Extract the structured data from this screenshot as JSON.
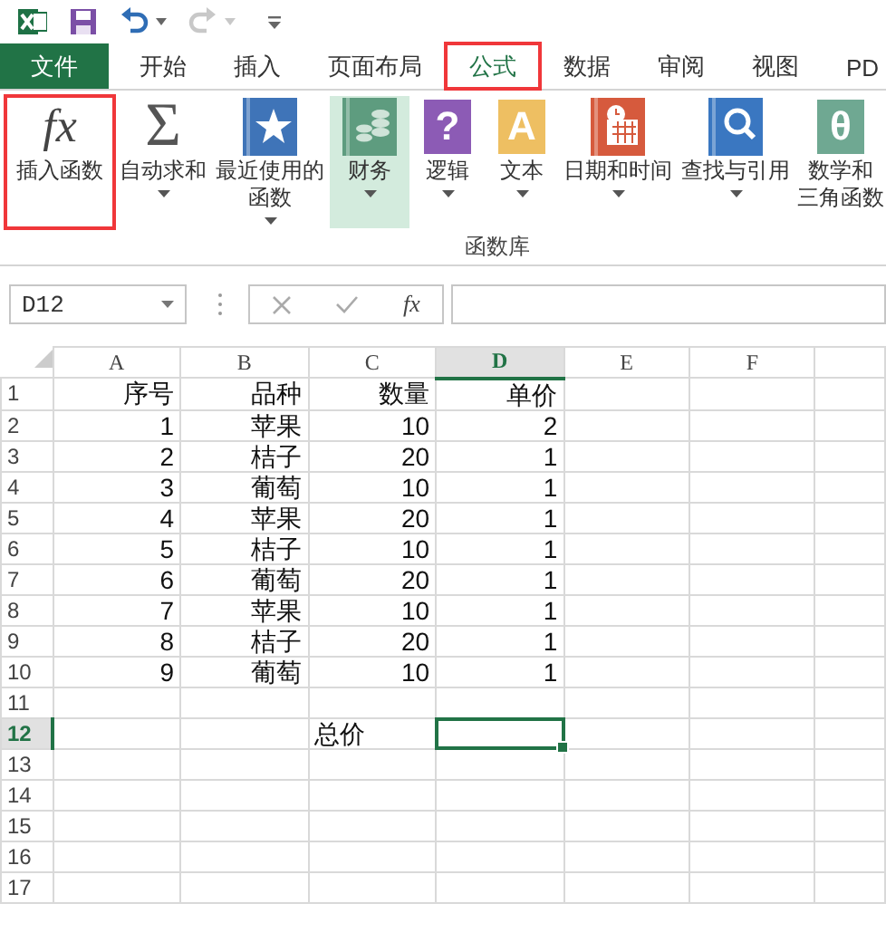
{
  "tabs": [
    {
      "label": "文件",
      "kind": "file",
      "selected": false,
      "highlighted": false
    },
    {
      "label": "开始",
      "kind": "tab",
      "selected": false,
      "highlighted": false
    },
    {
      "label": "插入",
      "kind": "tab",
      "selected": false,
      "highlighted": false
    },
    {
      "label": "页面布局",
      "kind": "tab",
      "selected": false,
      "highlighted": false
    },
    {
      "label": "公式",
      "kind": "tab",
      "selected": true,
      "highlighted": true
    },
    {
      "label": "数据",
      "kind": "tab",
      "selected": false,
      "highlighted": false
    },
    {
      "label": "审阅",
      "kind": "tab",
      "selected": false,
      "highlighted": false
    },
    {
      "label": "视图",
      "kind": "tab",
      "selected": false,
      "highlighted": false
    },
    {
      "label": "PD",
      "kind": "tab",
      "selected": false,
      "highlighted": false
    }
  ],
  "ribbon": {
    "group_label": "函数库",
    "buttons": [
      {
        "lines": [
          "插入函数"
        ],
        "kind": "glyph",
        "icon_text": "fx",
        "dropdown": false,
        "highlighted": true,
        "hovered": false
      },
      {
        "lines": [
          "自动求和"
        ],
        "kind": "glyph",
        "icon_text": "Σ",
        "dropdown": true,
        "highlighted": false,
        "hovered": false
      },
      {
        "lines": [
          "最近使用的",
          "函数"
        ],
        "kind": "star",
        "color": "#3f74b8",
        "dropdown": true,
        "highlighted": false,
        "hovered": false
      },
      {
        "lines": [
          "财务"
        ],
        "kind": "coins",
        "color": "#5e9c7f",
        "dropdown": true,
        "highlighted": false,
        "hovered": true
      },
      {
        "lines": [
          "逻辑"
        ],
        "kind": "letter",
        "icon_text": "?",
        "color": "#8c5bb5",
        "dropdown": true,
        "highlighted": false,
        "hovered": false
      },
      {
        "lines": [
          "文本"
        ],
        "kind": "letter",
        "icon_text": "A",
        "color": "#eebf62",
        "dropdown": true,
        "highlighted": false,
        "hovered": false
      },
      {
        "lines": [
          "日期和时间"
        ],
        "kind": "calendar",
        "color": "#d65a3d",
        "dropdown": true,
        "highlighted": false,
        "hovered": false
      },
      {
        "lines": [
          "查找与引用"
        ],
        "kind": "search",
        "color": "#3a77c1",
        "dropdown": true,
        "highlighted": false,
        "hovered": false
      },
      {
        "lines": [
          "数学和",
          "三角函数"
        ],
        "kind": "letter",
        "icon_text": "θ",
        "color": "#6fa892",
        "dropdown": false,
        "highlighted": false,
        "hovered": false
      }
    ]
  },
  "formula_bar": {
    "name_box": "D12",
    "fx": "fx"
  },
  "sheet": {
    "columns": [
      {
        "label": "A",
        "selected": false
      },
      {
        "label": "B",
        "selected": false
      },
      {
        "label": "C",
        "selected": false
      },
      {
        "label": "D",
        "selected": true
      },
      {
        "label": "E",
        "selected": false
      },
      {
        "label": "F",
        "selected": false
      }
    ],
    "rows": [
      {
        "label": "1",
        "selected": false,
        "cells": [
          "序号",
          "品种",
          "数量",
          "单价"
        ]
      },
      {
        "label": "2",
        "selected": false,
        "cells": [
          "1",
          "苹果",
          "10",
          "2"
        ]
      },
      {
        "label": "3",
        "selected": false,
        "cells": [
          "2",
          "桔子",
          "20",
          "1"
        ]
      },
      {
        "label": "4",
        "selected": false,
        "cells": [
          "3",
          "葡萄",
          "10",
          "1"
        ]
      },
      {
        "label": "5",
        "selected": false,
        "cells": [
          "4",
          "苹果",
          "20",
          "1"
        ]
      },
      {
        "label": "6",
        "selected": false,
        "cells": [
          "5",
          "桔子",
          "10",
          "1"
        ]
      },
      {
        "label": "7",
        "selected": false,
        "cells": [
          "6",
          "葡萄",
          "20",
          "1"
        ]
      },
      {
        "label": "8",
        "selected": false,
        "cells": [
          "7",
          "苹果",
          "10",
          "1"
        ]
      },
      {
        "label": "9",
        "selected": false,
        "cells": [
          "8",
          "桔子",
          "20",
          "1"
        ]
      },
      {
        "label": "10",
        "selected": false,
        "cells": [
          "9",
          "葡萄",
          "10",
          "1"
        ]
      },
      {
        "label": "11",
        "selected": false
      },
      {
        "label": "12",
        "selected": true,
        "total_label": "总价"
      },
      {
        "label": "13",
        "selected": false
      },
      {
        "label": "14",
        "selected": false
      },
      {
        "label": "15",
        "selected": false
      },
      {
        "label": "16",
        "selected": false
      },
      {
        "label": "17",
        "selected": false
      }
    ]
  }
}
